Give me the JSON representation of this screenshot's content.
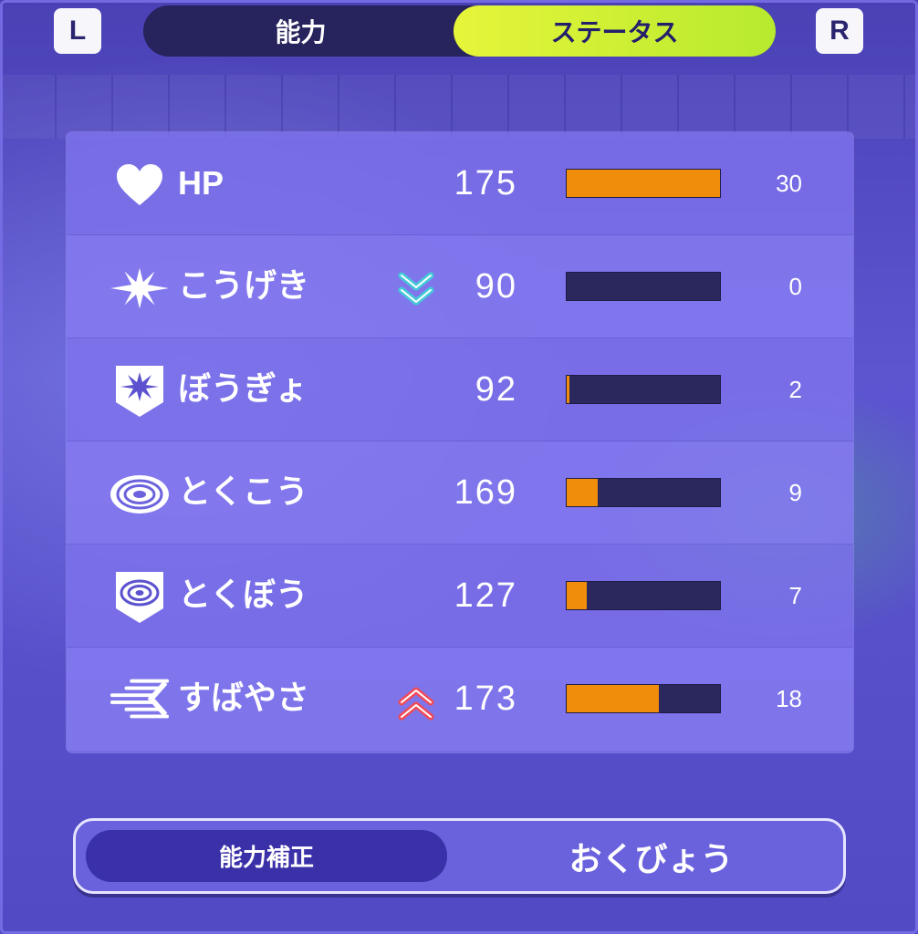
{
  "buttons": {
    "left": "L",
    "right": "R"
  },
  "tabs": {
    "ability": "能力",
    "status": "ステータス"
  },
  "stats": [
    {
      "name": "HP",
      "value": "175",
      "ev": "30",
      "fill": 1.0,
      "modifier": "none",
      "icon": "heart-icon"
    },
    {
      "name": "こうげき",
      "value": "90",
      "ev": "0",
      "fill": 0.0,
      "modifier": "down",
      "icon": "attack-burst-icon"
    },
    {
      "name": "ぼうぎょ",
      "value": "92",
      "ev": "2",
      "fill": 0.02,
      "modifier": "none",
      "icon": "defense-shield-icon"
    },
    {
      "name": "とくこう",
      "value": "169",
      "ev": "9",
      "fill": 0.2,
      "modifier": "none",
      "icon": "special-attack-rings-icon"
    },
    {
      "name": "とくぼう",
      "value": "127",
      "ev": "7",
      "fill": 0.13,
      "modifier": "none",
      "icon": "special-defense-shield-icon"
    },
    {
      "name": "すばやさ",
      "value": "173",
      "ev": "18",
      "fill": 0.6,
      "modifier": "up",
      "icon": "speed-lines-icon"
    }
  ],
  "nature": {
    "label": "能力補正",
    "value": "おくびょう"
  },
  "colors": {
    "bar_fill": "#f08d0a",
    "bar_track": "#2b285e",
    "status_tab": "#d4f036",
    "stat_down": "#43c9d9",
    "stat_up": "#ee4b59"
  }
}
